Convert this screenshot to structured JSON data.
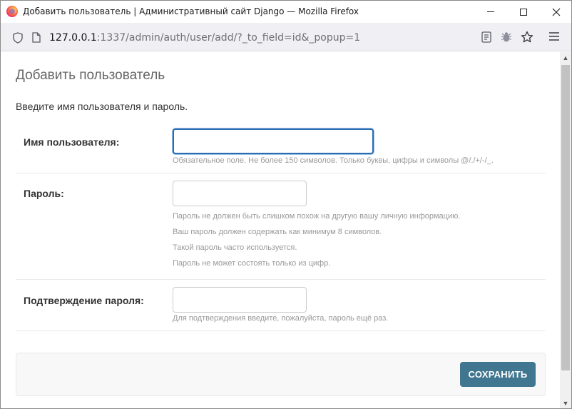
{
  "window": {
    "title": "Добавить пользователь | Административный сайт Django — Mozilla Firefox"
  },
  "address_bar": {
    "url_host": "127.0.0.1",
    "url_rest": ":1337/admin/auth/user/add/?_to_field=id&_popup=1"
  },
  "page": {
    "title": "Добавить пользователь",
    "intro": "Введите имя пользователя и пароль."
  },
  "form": {
    "username": {
      "label": "Имя пользователя:",
      "value": "",
      "help": "Обязательное поле. Не более 150 символов. Только буквы, цифры и символы @/./+/-/_."
    },
    "password1": {
      "label": "Пароль:",
      "value": "",
      "help": [
        "Пароль не должен быть слишком похож на другую вашу личную информацию.",
        "Ваш пароль должен содержать как минимум 8 символов.",
        "Такой пароль часто используется.",
        "Пароль не может состоять только из цифр."
      ]
    },
    "password2": {
      "label": "Подтверждение пароля:",
      "value": "",
      "help": "Для подтверждения введите, пожалуйста, пароль ещё раз."
    },
    "save_label": "СОХРАНИТЬ"
  },
  "colors": {
    "save_button": "#417690",
    "focus_border": "#2b6cb0"
  },
  "icons": [
    "firefox-logo",
    "minimize-icon",
    "maximize-icon",
    "close-icon",
    "shield-icon",
    "page-icon",
    "reader-view-icon",
    "extension-bug-icon",
    "bookmark-star-icon",
    "hamburger-menu-icon"
  ]
}
